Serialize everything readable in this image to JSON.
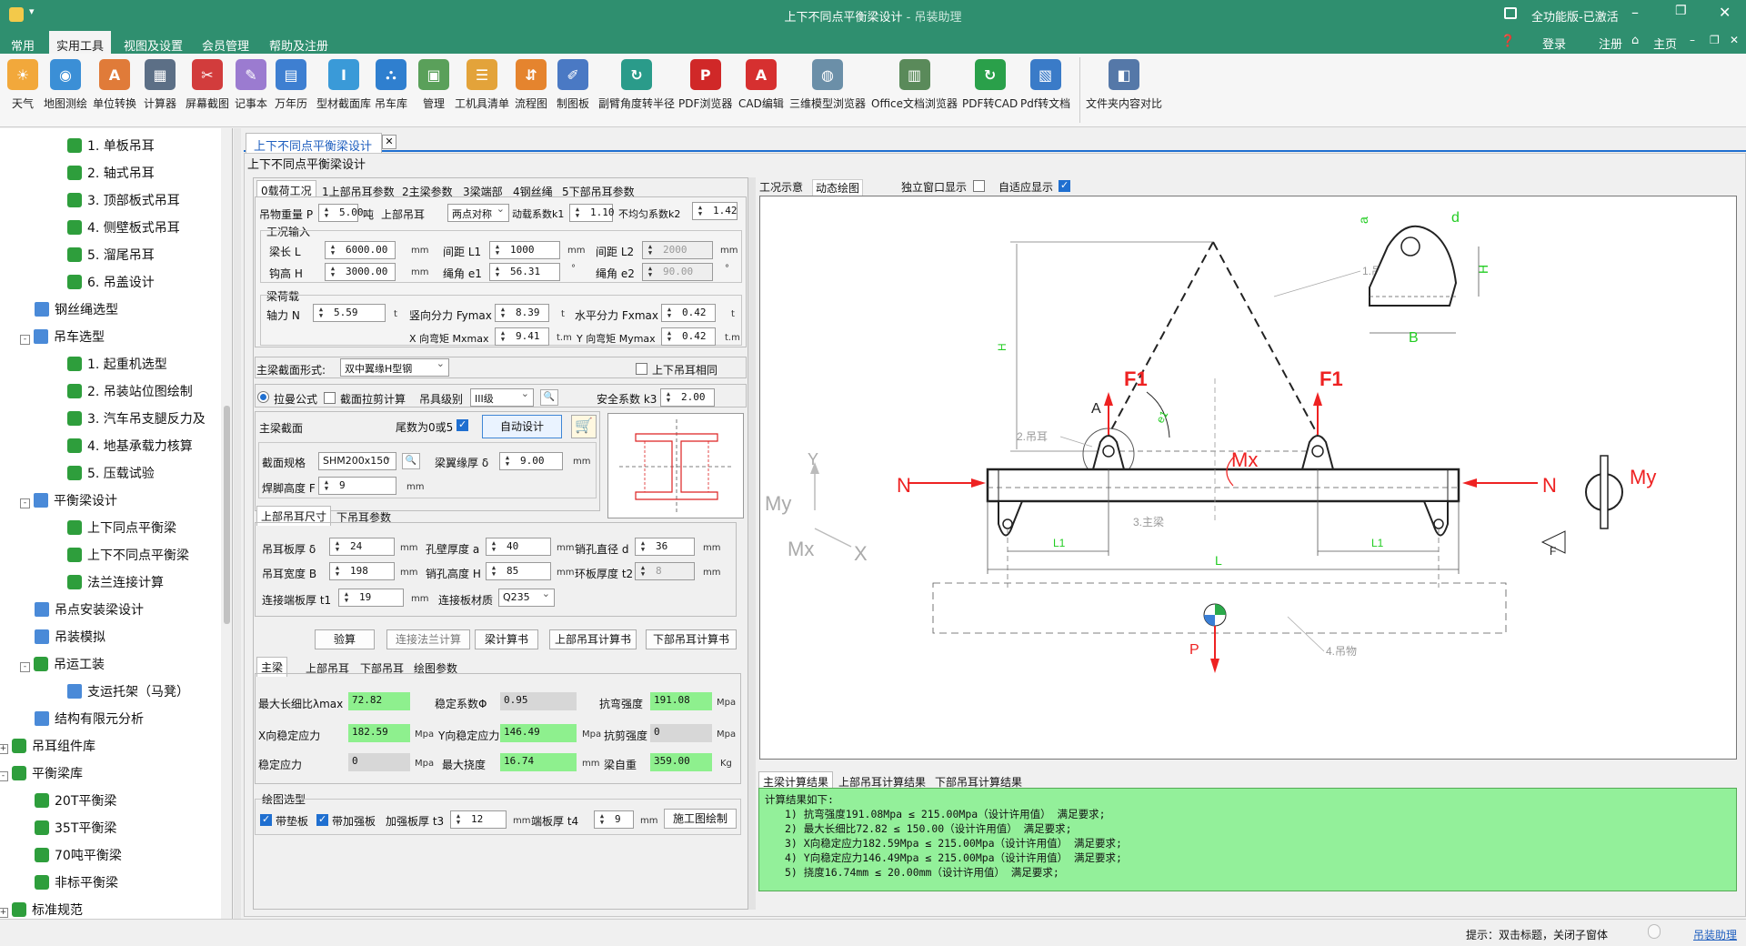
{
  "window": {
    "title": "上下不同点平衡梁设计",
    "app": "- 吊装助理",
    "license": "全功能版-已激活",
    "login": "登录",
    "register": "注册",
    "home": "主页"
  },
  "menu": [
    "常用",
    "实用工具",
    "视图及设置",
    "会员管理",
    "帮助及注册"
  ],
  "toolbar": [
    {
      "label": "天气",
      "color": "#f2a83b",
      "glyph": "☀"
    },
    {
      "label": "地图测绘",
      "color": "#3b8fd6",
      "glyph": "◉"
    },
    {
      "label": "单位转换",
      "color": "#e07b39",
      "glyph": "A"
    },
    {
      "label": "计算器",
      "color": "#5c6f86",
      "glyph": "▦"
    },
    {
      "label": "屏幕截图",
      "color": "#d23c3c",
      "glyph": "✂"
    },
    {
      "label": "记事本",
      "color": "#9b7bd0",
      "glyph": "✎"
    },
    {
      "label": "万年历",
      "color": "#3e7fd1",
      "glyph": "▤"
    },
    {
      "label": "型材截面库",
      "color": "#3a9ad8",
      "glyph": "I"
    },
    {
      "label": "吊车库",
      "color": "#2f7fcf",
      "glyph": "⛬"
    },
    {
      "label": "管理",
      "color": "#5aa05a",
      "glyph": "▣"
    },
    {
      "label": "工机具清单",
      "color": "#e3a33a",
      "glyph": "☰"
    },
    {
      "label": "流程图",
      "color": "#e5842e",
      "glyph": "⇵"
    },
    {
      "label": "制图板",
      "color": "#4a79c4",
      "glyph": "✐"
    },
    {
      "label": "副臂角度转半径",
      "color": "#2a9b8a",
      "glyph": "↻"
    },
    {
      "label": "PDF浏览器",
      "color": "#d02828",
      "glyph": "P"
    },
    {
      "label": "CAD编辑",
      "color": "#d63030",
      "glyph": "A"
    },
    {
      "label": "三维模型浏览器",
      "color": "#6b8fa8",
      "glyph": "◍"
    },
    {
      "label": "Office文档浏览器",
      "color": "#5a8a5a",
      "glyph": "▥"
    },
    {
      "label": "PDF转CAD",
      "color": "#2aa04a",
      "glyph": "↻"
    },
    {
      "label": "Pdf转文档",
      "color": "#3a7bc8",
      "glyph": "▧"
    },
    {
      "label": "文件夹内容对比",
      "color": "#5578a8",
      "glyph": "◧"
    }
  ],
  "tree": [
    {
      "label": "1. 单板吊耳",
      "level": 3,
      "icon": "leaf"
    },
    {
      "label": "2. 轴式吊耳",
      "level": 3,
      "icon": "leaf"
    },
    {
      "label": "3. 顶部板式吊耳",
      "level": 3,
      "icon": "leaf"
    },
    {
      "label": "4. 侧壁板式吊耳",
      "level": 3,
      "icon": "leaf"
    },
    {
      "label": "5. 溜尾吊耳",
      "level": 3,
      "icon": "leaf"
    },
    {
      "label": "6. 吊盖设计",
      "level": 3,
      "icon": "leaf"
    },
    {
      "label": "钢丝绳选型",
      "level": 2,
      "icon": "gear"
    },
    {
      "label": "吊车选型",
      "level": 2,
      "icon": "gear",
      "exp": "-"
    },
    {
      "label": "1. 起重机选型",
      "level": 3,
      "icon": "leaf"
    },
    {
      "label": "2. 吊装站位图绘制",
      "level": 3,
      "icon": "leaf"
    },
    {
      "label": "3. 汽车吊支腿反力及",
      "level": 3,
      "icon": "leaf"
    },
    {
      "label": "4. 地基承载力核算",
      "level": 3,
      "icon": "leaf"
    },
    {
      "label": "5. 压载试验",
      "level": 3,
      "icon": "leaf"
    },
    {
      "label": "平衡梁设计",
      "level": 2,
      "icon": "gear",
      "exp": "-"
    },
    {
      "label": "上下同点平衡梁",
      "level": 3,
      "icon": "leaf"
    },
    {
      "label": "上下不同点平衡梁",
      "level": 3,
      "icon": "leaf"
    },
    {
      "label": "法兰连接计算",
      "level": 3,
      "icon": "leaf"
    },
    {
      "label": "吊点安装梁设计",
      "level": 2,
      "icon": "gear"
    },
    {
      "label": "吊装模拟",
      "level": 2,
      "icon": "gear"
    },
    {
      "label": "吊运工装",
      "level": 2,
      "icon": "leaf",
      "exp": "-"
    },
    {
      "label": "支运托架（马凳）",
      "level": 3,
      "icon": "gear"
    },
    {
      "label": "结构有限元分析",
      "level": 2,
      "icon": "gear"
    },
    {
      "label": "吊耳组件库",
      "level": 1,
      "icon": "leaf",
      "exp": "+"
    },
    {
      "label": "平衡梁库",
      "level": 1,
      "icon": "leaf",
      "exp": "-"
    },
    {
      "label": "20T平衡梁",
      "level": 2,
      "icon": "leaf"
    },
    {
      "label": "35T平衡梁",
      "level": 2,
      "icon": "leaf"
    },
    {
      "label": "70吨平衡梁",
      "level": 2,
      "icon": "leaf"
    },
    {
      "label": "非标平衡梁",
      "level": 2,
      "icon": "leaf"
    },
    {
      "label": "标准规范",
      "level": 1,
      "icon": "leaf",
      "exp": "+"
    }
  ],
  "doc": {
    "tab": "上下不同点平衡梁设计",
    "panel_title": "上下不同点平衡梁设计"
  },
  "form": {
    "tabs": [
      "0载荷工况",
      "1上部吊耳参数",
      "2主梁参数",
      "3梁端部",
      "4钢丝绳",
      "5下部吊耳参数"
    ],
    "weight_label": "吊物重量 P",
    "weight": "5.00",
    "weight_unit": "吨",
    "upper_lug_label": "上部吊耳",
    "upper_lug": "两点对称",
    "k1_label": "动载系数k1",
    "k1": "1.10",
    "k2_label": "不均匀系数k2",
    "k2": "1.42",
    "cond_group": "工况输入",
    "L_label": "梁长 L",
    "L": "6000.00",
    "L_unit": "mm",
    "L1_label": "间距 L1",
    "L1": "1000",
    "L1_unit": "mm",
    "L2_label": "间距 L2",
    "L2": "2000",
    "L2_unit": "mm",
    "H_label": "钩高 H",
    "H": "3000.00",
    "H_unit": "mm",
    "e1_label": "绳角 e1",
    "e1": "56.31",
    "e1_unit": "°",
    "e2_label": "绳角 e2",
    "e2": "90.00",
    "e2_unit": "°",
    "load_group": "梁荷载",
    "N_label": "轴力 N",
    "N": "5.59",
    "N_unit": "t",
    "Fy_label": "竖向分力 Fymax",
    "Fy": "8.39",
    "Fy_unit": "t",
    "Fx_label": "水平分力 Fxmax",
    "Fx": "0.42",
    "Fx_unit": "t",
    "Mx_label": "X 向弯矩 Mxmax",
    "Mx": "9.41",
    "Mx_unit": "t.m",
    "My_label": "Y 向弯矩 Mymax",
    "My": "0.42",
    "My_unit": "t.m",
    "section_form_label": "主梁截面形式:",
    "section_form": "双中翼缘H型钢",
    "same_lug_label": "上下吊耳相同",
    "formula1": "拉曼公式",
    "formula2": "截面拉剪计算",
    "grade_label": "吊具级别",
    "grade": "III级",
    "k3_label": "安全系数 k3",
    "k3": "2.00",
    "main_section_label": "主梁截面",
    "tail_label": "尾数为0或5",
    "auto_design": "自动设计",
    "spec_label": "截面规格",
    "spec": "SHM200x150",
    "flange_label": "梁翼缘厚 δ",
    "flange": "9.00",
    "flange_unit": "mm",
    "weld_label": "焊脚高度 F",
    "weld": "9",
    "weld_unit": "mm",
    "subtabs": [
      "上部吊耳尺寸",
      "下吊耳参数"
    ],
    "lug_t_label": "吊耳板厚 δ",
    "lug_t": "24",
    "hole_wall_label": "孔壁厚度 a",
    "hole_wall": "40",
    "pin_d_label": "销孔直径 d",
    "pin_d": "36",
    "lug_w_label": "吊耳宽度 B",
    "lug_w": "198",
    "pin_h_label": "销孔高度 H",
    "pin_h": "85",
    "ring_label": "环板厚度 t2",
    "ring": "8",
    "end_plate_label": "连接端板厚 t1",
    "end_plate": "19",
    "material_label": "连接板材质",
    "material": "Q235",
    "mm": "mm",
    "buttons": [
      "验算",
      "连接法兰计算",
      "梁计算书",
      "上部吊耳计算书",
      "下部吊耳计算书"
    ],
    "result_tabs": [
      "主梁",
      "上部吊耳",
      "下部吊耳",
      "绘图参数"
    ],
    "slender_label": "最大长细比λmax",
    "slender": "72.82",
    "stab_coef_label": "稳定系数Φ",
    "stab_coef": "0.95",
    "bend_label": "抗弯强度",
    "bend": "191.08",
    "bend_unit": "Mpa",
    "xstab_label": "X向稳定应力",
    "xstab": "182.59",
    "xstab_unit": "Mpa",
    "ystab_label": "Y向稳定应力",
    "ystab": "146.49",
    "ystab_unit": "Mpa",
    "shear_label": "抗剪强度",
    "shear": "0",
    "shear_unit": "Mpa",
    "stab_label": "稳定应力",
    "stab": "0",
    "stab_unit": "Mpa",
    "defl_label": "最大挠度",
    "defl": "16.74",
    "defl_unit": "mm",
    "selfw_label": "梁自重",
    "selfw": "359.00",
    "selfw_unit": "Kg",
    "draw_group": "绘图选型",
    "pad_label": "带垫板",
    "rib_label": "带加强板",
    "t3_label": "加强板厚 t3",
    "t3": "12",
    "t4_label": "端板厚 t4",
    "t4": "9",
    "draw_btn": "施工图绘制"
  },
  "right": {
    "tabs": [
      "工况示意",
      "动态绘图"
    ],
    "standalone": "独立窗口显示",
    "adaptive": "自适应显示",
    "drawing_labels": {
      "rope": "1.吊索",
      "lug": "2.吊耳",
      "beam": "3.主梁",
      "load": "4.吊物",
      "F1a": "F1",
      "F1b": "F1",
      "A": "A",
      "e1": "e1",
      "Mx": "Mx",
      "N1": "N",
      "N2": "N",
      "My": "My",
      "My2": "My",
      "Y": "Y",
      "X": "X",
      "Mx2": "Mx",
      "L1a": "L1",
      "L1b": "L1",
      "L": "L",
      "H": "H",
      "P": "P",
      "a": "a",
      "d": "d",
      "H2": "H",
      "B": "B",
      "F": "F"
    },
    "result_tabs": [
      "主梁计算结果",
      "上部吊耳计算结果",
      "下部吊耳计算结果"
    ],
    "results_title": "计算结果如下:",
    "results": [
      "1) 抗弯强度191.08Mpa ≤ 215.00Mpa（设计许用值） 满足要求;",
      "2) 最大长细比72.82 ≤ 150.00（设计许用值） 满足要求;",
      "3) X向稳定应力182.59Mpa ≤ 215.00Mpa（设计许用值） 满足要求;",
      "4) Y向稳定应力146.49Mpa ≤ 215.00Mpa（设计许用值） 满足要求;",
      "5) 挠度16.74mm ≤ 20.00mm（设计许用值） 满足要求;"
    ]
  },
  "status": {
    "hint": "提示：双击标题，关闭子窗体",
    "link": "吊装助理"
  }
}
